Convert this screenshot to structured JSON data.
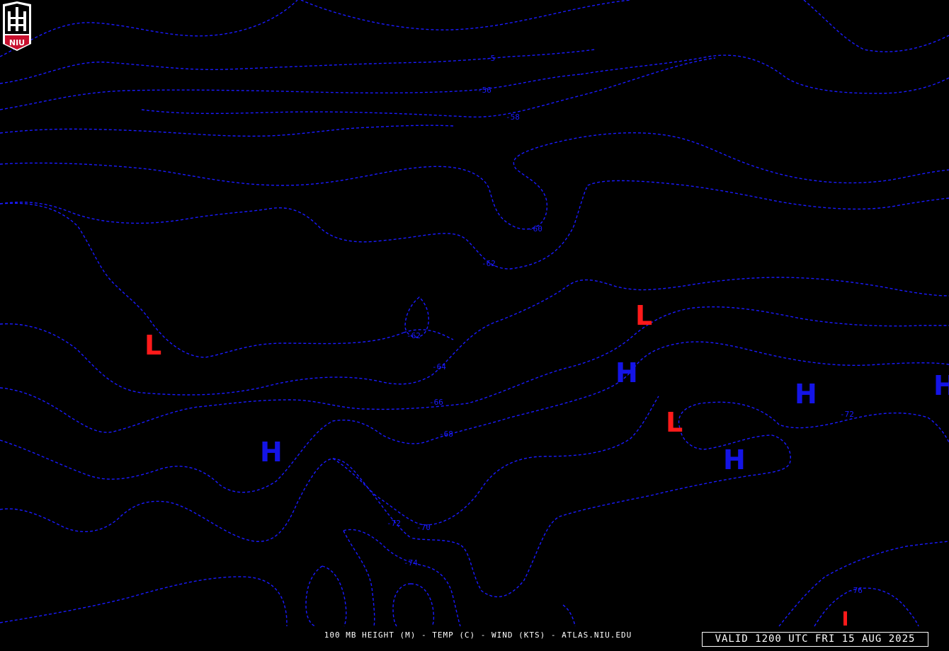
{
  "product": {
    "footer_title": "100 MB HEIGHT (M) - TEMP (C) - WIND (KTS) - ATLAS.NIU.EDU",
    "valid_time": "VALID 1200 UTC FRI 15 AUG 2025"
  },
  "logo": {
    "text": "NIU",
    "color": "#c8102e"
  },
  "colors": {
    "background": "#000000",
    "isotherm": "#1a1aff",
    "high": "#1414e6",
    "low": "#ff1a1a"
  },
  "isotherm_labels": [
    "-5",
    "-56",
    "-58",
    "-60",
    "-62",
    "-62",
    "-64",
    "-66",
    "-68",
    "-70",
    "-72",
    "-72",
    "-74",
    "-76"
  ],
  "pressure_centers": [
    {
      "type": "H",
      "color": "blue"
    },
    {
      "type": "H",
      "color": "blue"
    },
    {
      "type": "H",
      "color": "blue"
    },
    {
      "type": "H",
      "color": "blue"
    },
    {
      "type": "H",
      "color": "blue"
    },
    {
      "type": "L",
      "color": "red"
    },
    {
      "type": "L",
      "color": "red"
    },
    {
      "type": "L",
      "color": "red"
    },
    {
      "type": "L",
      "color": "red"
    }
  ]
}
